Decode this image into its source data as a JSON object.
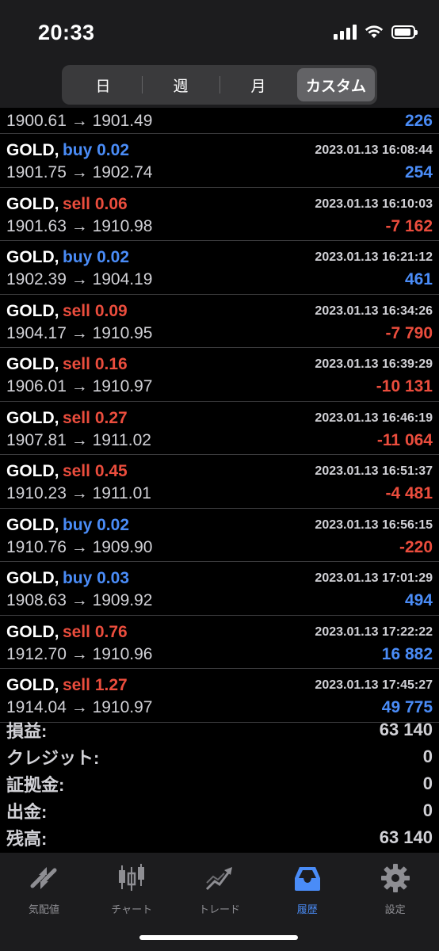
{
  "status_bar": {
    "time": "20:33",
    "battery_level": 0.9
  },
  "period_tabs": [
    {
      "label": "日",
      "active": false
    },
    {
      "label": "週",
      "active": false
    },
    {
      "label": "月",
      "active": false
    },
    {
      "label": "カスタム",
      "active": true
    }
  ],
  "deals": [
    {
      "symbol": "",
      "side": "",
      "time": "",
      "prices": "1900.61 → 1901.49",
      "profit": "226",
      "profit_sign": "pos",
      "partial": true
    },
    {
      "symbol": "GOLD,",
      "side": "buy 0.02",
      "side_type": "buy",
      "time": "2023.01.13 16:08:44",
      "prices": "1901.75 → 1902.74",
      "profit": "254",
      "profit_sign": "pos"
    },
    {
      "symbol": "GOLD,",
      "side": "sell 0.06",
      "side_type": "sell",
      "time": "2023.01.13 16:10:03",
      "prices": "1901.63 → 1910.98",
      "profit": "-7 162",
      "profit_sign": "neg"
    },
    {
      "symbol": "GOLD,",
      "side": "buy 0.02",
      "side_type": "buy",
      "time": "2023.01.13 16:21:12",
      "prices": "1902.39 → 1904.19",
      "profit": "461",
      "profit_sign": "pos"
    },
    {
      "symbol": "GOLD,",
      "side": "sell 0.09",
      "side_type": "sell",
      "time": "2023.01.13 16:34:26",
      "prices": "1904.17 → 1910.95",
      "profit": "-7 790",
      "profit_sign": "neg"
    },
    {
      "symbol": "GOLD,",
      "side": "sell 0.16",
      "side_type": "sell",
      "time": "2023.01.13 16:39:29",
      "prices": "1906.01 → 1910.97",
      "profit": "-10 131",
      "profit_sign": "neg"
    },
    {
      "symbol": "GOLD,",
      "side": "sell 0.27",
      "side_type": "sell",
      "time": "2023.01.13 16:46:19",
      "prices": "1907.81 → 1911.02",
      "profit": "-11 064",
      "profit_sign": "neg"
    },
    {
      "symbol": "GOLD,",
      "side": "sell 0.45",
      "side_type": "sell",
      "time": "2023.01.13 16:51:37",
      "prices": "1910.23 → 1911.01",
      "profit": "-4 481",
      "profit_sign": "neg"
    },
    {
      "symbol": "GOLD,",
      "side": "buy 0.02",
      "side_type": "buy",
      "time": "2023.01.13 16:56:15",
      "prices": "1910.76 → 1909.90",
      "profit": "-220",
      "profit_sign": "neg"
    },
    {
      "symbol": "GOLD,",
      "side": "buy 0.03",
      "side_type": "buy",
      "time": "2023.01.13 17:01:29",
      "prices": "1908.63 → 1909.92",
      "profit": "494",
      "profit_sign": "pos"
    },
    {
      "symbol": "GOLD,",
      "side": "sell 0.76",
      "side_type": "sell",
      "time": "2023.01.13 17:22:22",
      "prices": "1912.70 → 1910.96",
      "profit": "16 882",
      "profit_sign": "pos"
    },
    {
      "symbol": "GOLD,",
      "side": "sell 1.27",
      "side_type": "sell",
      "time": "2023.01.13 17:45:27",
      "prices": "1914.04 → 1910.97",
      "profit": "49 775",
      "profit_sign": "pos"
    }
  ],
  "summary": [
    {
      "label": "損益:",
      "value": "63 140"
    },
    {
      "label": "クレジット:",
      "value": "0"
    },
    {
      "label": "証拠金:",
      "value": "0"
    },
    {
      "label": "出金:",
      "value": "0"
    },
    {
      "label": "残高:",
      "value": "63 140"
    }
  ],
  "tabbar": [
    {
      "label": "気配値",
      "icon": "quotes-icon",
      "active": false
    },
    {
      "label": "チャート",
      "icon": "chart-icon",
      "active": false
    },
    {
      "label": "トレード",
      "icon": "trade-icon",
      "active": false
    },
    {
      "label": "履歴",
      "icon": "history-icon",
      "active": true
    },
    {
      "label": "設定",
      "icon": "settings-icon",
      "active": false
    }
  ],
  "colors": {
    "buy": "#4a8cf7",
    "sell": "#eb4d3d",
    "inactive": "#8e8e93"
  }
}
